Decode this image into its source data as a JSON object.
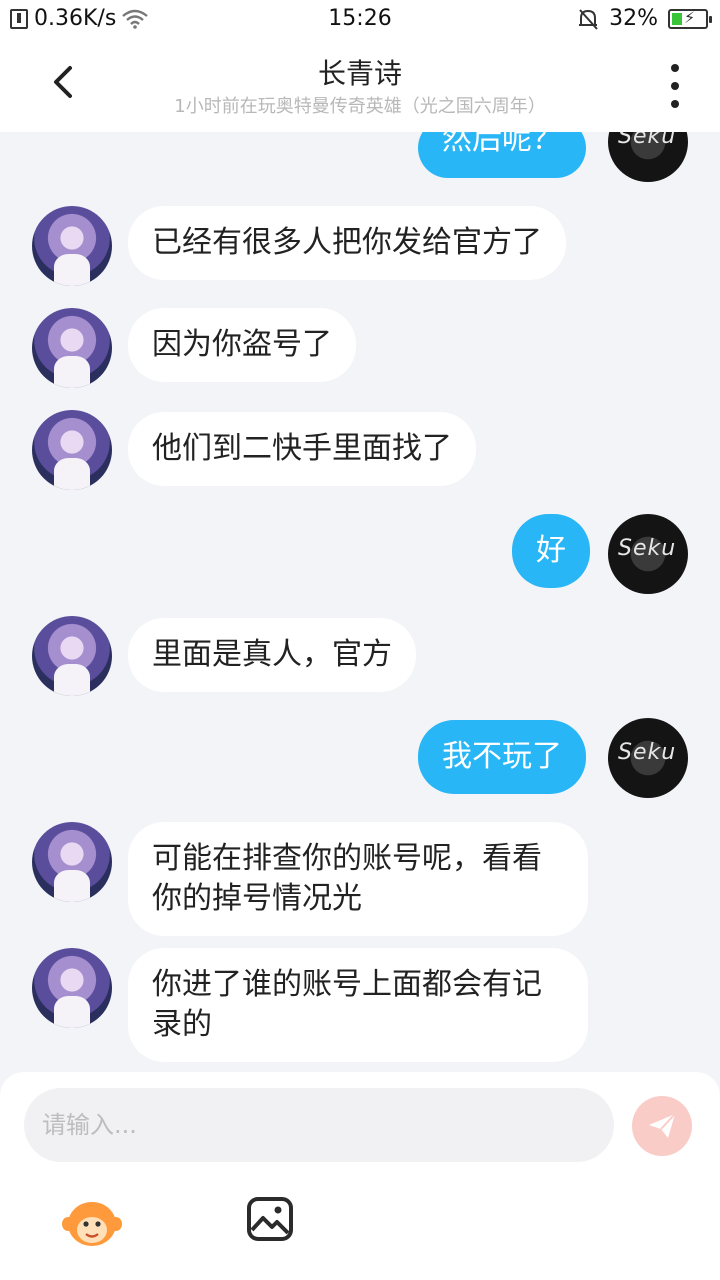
{
  "status_bar": {
    "speed": "0.36K/s",
    "time": "15:26",
    "battery": "32%"
  },
  "header": {
    "back_icon": "chevron-left-icon",
    "title": "长青诗",
    "subtitle": "1小时前在玩奥特曼传奇英雄（光之国六周年）",
    "more_icon": "more-vertical-icon"
  },
  "messages": [
    {
      "sender": "self",
      "text": "然后呢？"
    },
    {
      "sender": "other",
      "text": "已经有很多人把你发给官方了"
    },
    {
      "sender": "other",
      "text": "因为你盗号了"
    },
    {
      "sender": "other",
      "text": "他们到二快手里面找了"
    },
    {
      "sender": "self",
      "text": "好"
    },
    {
      "sender": "other",
      "text": "里面是真人，官方"
    },
    {
      "sender": "self",
      "text": "我不玩了"
    },
    {
      "sender": "other",
      "text": "可能在排查你的账号呢，看看\n你的掉号情况光"
    },
    {
      "sender": "other",
      "text": "你进了谁的账号上面都会有记\n录的"
    }
  ],
  "avatars": {
    "self_signature": "Seku"
  },
  "composer": {
    "placeholder": "请输入...",
    "send_icon": "send-icon",
    "emoji_icon": "emoji-icon",
    "image_icon": "image-icon"
  },
  "colors": {
    "self_bubble": "#29b6f6",
    "other_bubble": "#ffffff",
    "background": "#f3f4f8",
    "send_button": "#f9ccc7"
  }
}
